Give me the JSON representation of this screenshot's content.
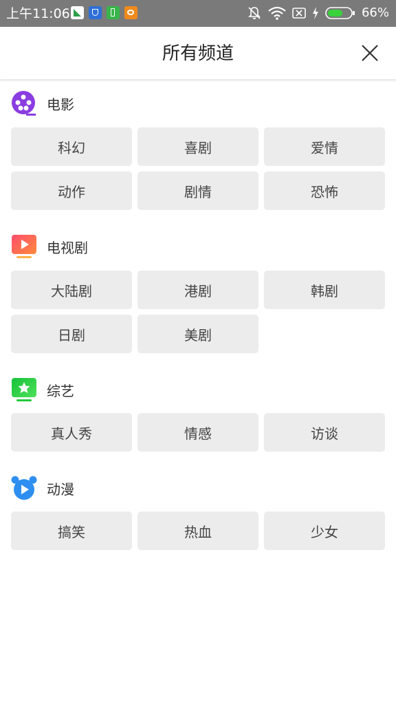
{
  "status_bar": {
    "time": "上午11:06",
    "battery_percent": "66%",
    "battery_level": 0.66,
    "battery_color": "#39d13c"
  },
  "header": {
    "title": "所有频道",
    "close_icon": "close-icon"
  },
  "sections": [
    {
      "title": "电影",
      "icon": "film-reel-icon",
      "color": "#8a3de0",
      "tags": [
        "科幻",
        "喜剧",
        "爱情",
        "动作",
        "剧情",
        "恐怖"
      ]
    },
    {
      "title": "电视剧",
      "icon": "tv-play-icon",
      "color": "#ff5a5a",
      "tags": [
        "大陆剧",
        "港剧",
        "韩剧",
        "日剧",
        "美剧"
      ]
    },
    {
      "title": "综艺",
      "icon": "variety-star-icon",
      "color": "#22c93a",
      "tags": [
        "真人秀",
        "情感",
        "访谈"
      ]
    },
    {
      "title": "动漫",
      "icon": "bear-play-icon",
      "color": "#2f8ff0",
      "tags": [
        "搞笑",
        "热血",
        "少女"
      ]
    }
  ]
}
